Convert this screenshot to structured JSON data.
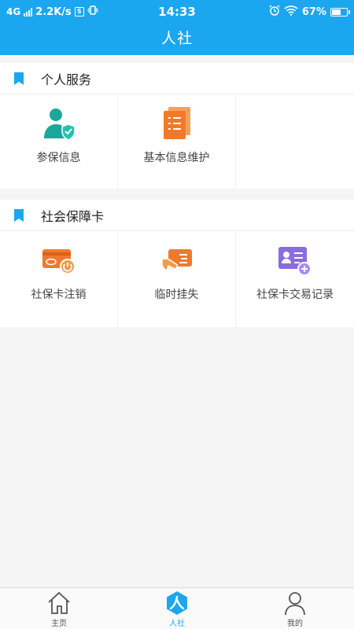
{
  "status_bar": {
    "network": "4G",
    "speed": "2.2K/s",
    "s_icon": "S",
    "time": "14:33",
    "battery": "67%",
    "battery_level": 0.67
  },
  "header": {
    "title": "人社"
  },
  "sections": [
    {
      "title": "个人服务",
      "items": [
        {
          "label": "参保信息",
          "icon": "person-shield-icon"
        },
        {
          "label": "基本信息维护",
          "icon": "document-list-icon"
        }
      ]
    },
    {
      "title": "社会保障卡",
      "items": [
        {
          "label": "社保卡注销",
          "icon": "card-power-icon"
        },
        {
          "label": "临时挂失",
          "icon": "hand-card-icon"
        },
        {
          "label": "社保卡交易记录",
          "icon": "id-card-plus-icon"
        }
      ]
    }
  ],
  "tabbar": {
    "items": [
      {
        "label": "主页",
        "icon": "home-icon"
      },
      {
        "label": "人社",
        "icon": "person-hex-icon",
        "active": true
      },
      {
        "label": "我的",
        "icon": "user-icon"
      }
    ]
  },
  "colors": {
    "primary": "#1aa7f0",
    "orange": "#f07a2b",
    "teal": "#1aa79b",
    "purple": "#8a6be0"
  }
}
